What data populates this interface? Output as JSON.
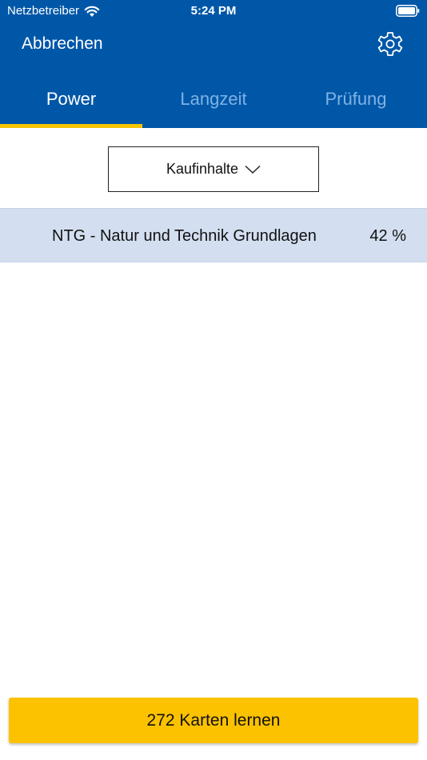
{
  "status_bar": {
    "carrier": "Netzbetreiber",
    "time": "5:24 PM",
    "icons": [
      "wifi-icon",
      "battery-icon"
    ]
  },
  "nav": {
    "cancel_label": "Abbrechen",
    "settings_icon": "gear-icon"
  },
  "tabs": [
    {
      "label": "Power",
      "active": true
    },
    {
      "label": "Langzeit",
      "active": false
    },
    {
      "label": "Prüfung",
      "active": false
    }
  ],
  "filter": {
    "selected": "Kaufinhalte",
    "icon": "chevron-down-icon"
  },
  "list": [
    {
      "title": "NTG - Natur und Technik Grundlagen",
      "percent": "42 %"
    }
  ],
  "action": {
    "learn_label": "272 Karten lernen"
  },
  "colors": {
    "header": "#0057a8",
    "tab_indicator": "#f7c400",
    "row_background": "#d3dff0",
    "button": "#fcc200"
  }
}
